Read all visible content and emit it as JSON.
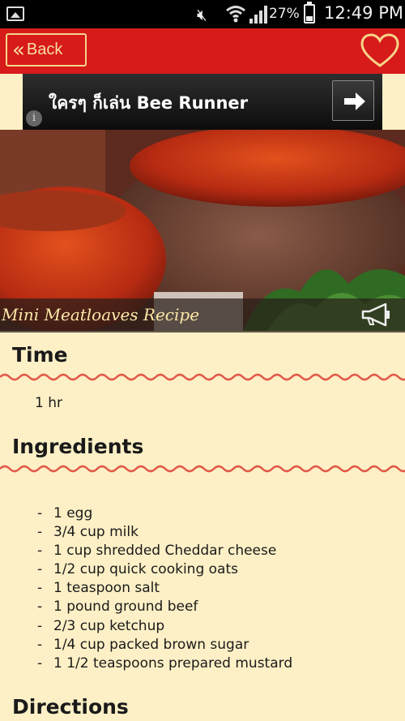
{
  "status_bar": {
    "battery_percent": "27%",
    "time": "12:49 PM",
    "icons": [
      "image-icon",
      "mute-icon",
      "wifi-icon",
      "signal-icon",
      "battery-icon"
    ]
  },
  "app_bar": {
    "back_label": "Back",
    "favorite_icon": "heart-icon",
    "color": "#d71a1a"
  },
  "ad": {
    "text": "ใครๆ ก็เล่น Bee Runner",
    "arrow_icon": "arrow-right-icon",
    "info_icon": "info-icon"
  },
  "recipe": {
    "title": "Mini Meatloaves Recipe",
    "speaker_icon": "megaphone-icon",
    "sections": {
      "time_heading": "Time",
      "time_value": "1 hr",
      "ingredients_heading": "Ingredients",
      "directions_heading": "Directions"
    },
    "ingredients": [
      "1 egg",
      "3/4 cup milk",
      "1 cup shredded Cheddar cheese",
      "1/2 cup quick cooking oats",
      "1 teaspoon salt",
      "1 pound ground beef",
      "2/3 cup ketchup",
      "1/4 cup packed brown sugar",
      "1 1/2 teaspoons prepared mustard"
    ]
  }
}
